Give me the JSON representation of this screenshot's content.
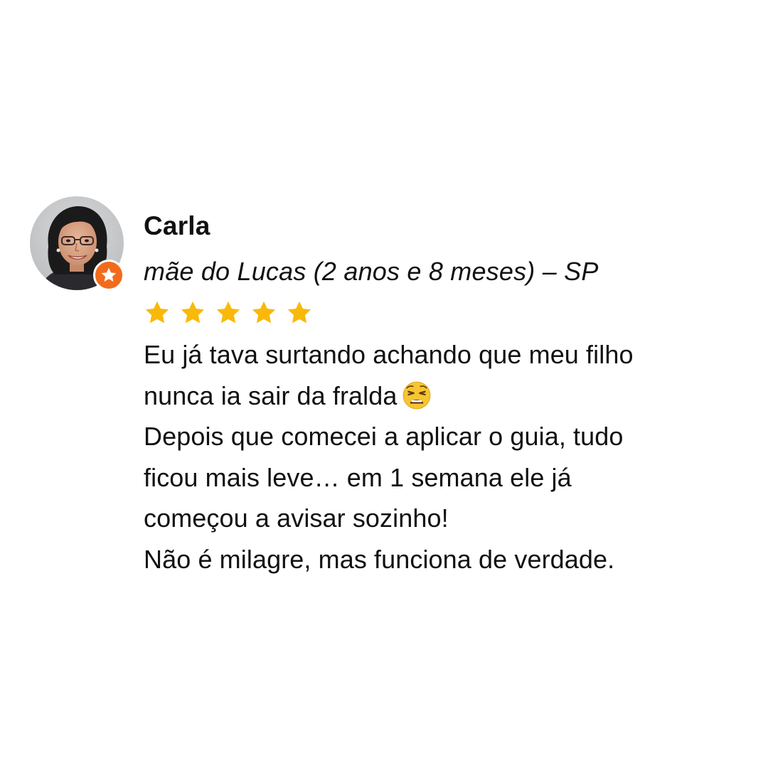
{
  "review": {
    "author_name": "Carla",
    "author_subtitle": "mãe do Lucas (2 anos e 8 meses) – SP",
    "rating": 5,
    "rating_max": 5,
    "badge_icon": "star-icon",
    "badge_color": "#f26b1d",
    "star_color": "#f9b90a",
    "lines": [
      "Eu já tava surtando achando que meu filho",
      "nunca ia sair da fralda",
      "Depois que comecei a aplicar o guia, tudo",
      "ficou mais leve… em 1 semana ele já",
      "começou a avisar sozinho!",
      "Não é milagre, mas funciona de verdade."
    ],
    "emoji_icon": "weary-face-icon"
  }
}
